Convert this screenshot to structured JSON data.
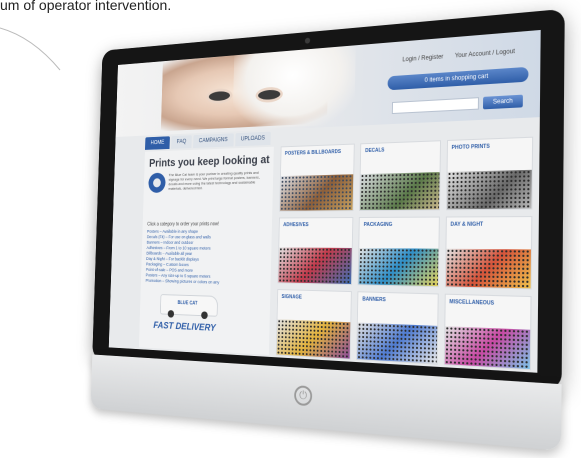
{
  "caption": "um of operator intervention.",
  "colors": {
    "accent": "#2f5ea8",
    "bezel": "#151515",
    "screen_bg": "#e8eaec"
  },
  "site": {
    "header": {
      "link_left": "Login / Register",
      "link_right": "Your Account / Logout",
      "cart_button": "0 items in shopping cart",
      "search_placeholder": "",
      "search_button": "Search"
    },
    "nav": {
      "tabs": [
        {
          "label": "HOME",
          "active": true
        },
        {
          "label": "FAQ",
          "active": false
        },
        {
          "label": "CAMPAIGNS",
          "active": false
        },
        {
          "label": "UPLOADS",
          "active": false
        }
      ]
    },
    "left": {
      "title": "Prints you keep looking at",
      "paragraph": "The Blue Cat team is your partner in creating quality prints and signage for every need. We print large format posters, banners, decals and more using the latest technology and sustainable materials, delivered fast.",
      "categories_intro": "Click a category to order your prints now!",
      "categories": [
        "Posters – Available in any shape",
        "Decals (Fit) – For use on glass and walls",
        "Banners – Indoor and outdoor",
        "Adhesives – From 1 to 10 square meters",
        "Billboards – Available all year",
        "Day & Night – For backlit displays",
        "Packaging – Custom boxes",
        "Point-of-sale – POS and more",
        "Posters – Any size up to 5 square meters",
        "Promotion – Showing pictures or colors on any"
      ],
      "van_logo": "BLUE CAT",
      "fast_delivery": "FAST DELIVERY"
    },
    "products": [
      {
        "title": "POSTERS & BILLBOARDS"
      },
      {
        "title": "DECALS"
      },
      {
        "title": "PHOTO PRINTS"
      },
      {
        "title": "ADHESIVES"
      },
      {
        "title": "PACKAGING"
      },
      {
        "title": "DAY & NIGHT"
      },
      {
        "title": "SIGNAGE"
      },
      {
        "title": "BANNERS"
      },
      {
        "title": "MISCELLANEOUS"
      }
    ]
  },
  "icons": {
    "power": "power-icon",
    "camera": "camera-icon",
    "mascot": "cat-logo-icon",
    "van": "delivery-van-icon"
  }
}
